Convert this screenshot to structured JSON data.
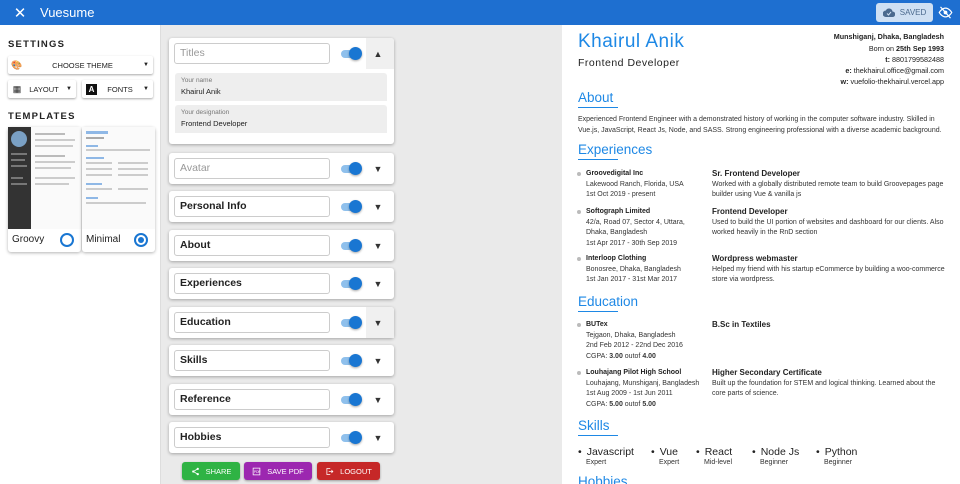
{
  "app": {
    "title": "Vuesume",
    "saved_label": "SAVED"
  },
  "settings": {
    "heading": "SETTINGS",
    "theme_label": "CHOOSE THEME",
    "layout_label": "LAYOUT",
    "fonts_label": "FONTS"
  },
  "templates": {
    "heading": "TEMPLATES",
    "items": [
      {
        "name": "Groovy",
        "selected": false
      },
      {
        "name": "Minimal",
        "selected": true
      }
    ]
  },
  "editor": {
    "titles": {
      "placeholder": "Titles",
      "name_label": "Your name",
      "name_value": "Khairul Anik",
      "designation_label": "Your designation",
      "designation_value": "Frontend Developer"
    },
    "avatar_placeholder": "Avatar",
    "sections": [
      "Personal Info",
      "About",
      "Experiences",
      "Education",
      "Skills",
      "Reference",
      "Hobbies"
    ],
    "actions": {
      "share": "SHARE",
      "save_pdf": "SAVE PDF",
      "logout": "LOGOUT"
    }
  },
  "colors": {
    "primary": "#1e6fd0",
    "accent": "#1e88e5",
    "share": "#2fb344",
    "pdf": "#9c27b0",
    "logout": "#c62828"
  },
  "resume": {
    "name": "Khairul Anik",
    "designation": "Frontend Developer",
    "address": "Munshiganj, Dhaka, Bangladesh",
    "born_prefix": "Born on ",
    "born": "25th Sep 1993",
    "phone_label": "t: ",
    "phone": "8801799582488",
    "email_label": "e: ",
    "email": "thekhairul.office@gmail.com",
    "web_label": "w: ",
    "web": "vuefolio-thekhairul.vercel.app",
    "about_title": "About",
    "about_text": "Experienced Frontend Engineer with a demonstrated history of working in the computer software industry. Skilled in Vue.js, JavaScript, React Js, Node, and SASS. Strong engineering professional with a diverse academic background.",
    "exp_title": "Experiences",
    "experiences": [
      {
        "company": "Groovedigital Inc",
        "location": "Lakewood Ranch, Florida, USA",
        "dates": "1st Oct 2019 - present",
        "role": "Sr. Frontend Developer",
        "desc": "Worked with a globally distributed remote team to build Groovepages page builder using Vue & vanilla js"
      },
      {
        "company": "Softograph Limited",
        "location": "42/a, Road 07, Sector 4, Uttara, Dhaka, Bangladesh",
        "dates": "1st Apr 2017 - 30th Sep 2019",
        "role": "Frontend Developer",
        "desc": "Used to build the UI portion of websites and dashboard for our clients. Also worked heavily in the RnD section"
      },
      {
        "company": "Interloop Clothing",
        "location": "Bonosree, Dhaka, Bangladesh",
        "dates": "1st Jan 2017 - 31st Mar 2017",
        "role": "Wordpress webmaster",
        "desc": "Helped my friend with his startup eCommerce by building a woo-commerce store via wordpress."
      }
    ],
    "edu_title": "Education",
    "education": [
      {
        "school": "BUTex",
        "location": "Tejgaon, Dhaka, Bangladesh",
        "dates": "2nd Feb 2012 - 22nd Dec 2016",
        "gpa_label": "CGPA: ",
        "gpa": "3.00",
        "gpa_sep": " outof ",
        "gpa_max": "4.00",
        "degree": "B.Sc in Textiles",
        "desc": ""
      },
      {
        "school": "Louhajang Pilot High School",
        "location": "Louhajang, Munshiganj, Bangladesh",
        "dates": "1st Aug 2009 - 1st Jun 2011",
        "gpa_label": "CGPA: ",
        "gpa": "5.00",
        "gpa_sep": " outof ",
        "gpa_max": "5.00",
        "degree": "Higher Secondary Certificate",
        "desc": "Built up the foundation for STEM and logical thinking. Learned about the core parts of science."
      }
    ],
    "skills_title": "Skills",
    "skills": [
      {
        "name": "Javascript",
        "level": "Expert"
      },
      {
        "name": "Vue",
        "level": "Expert"
      },
      {
        "name": "React",
        "level": "Mid-level"
      },
      {
        "name": "Node Js",
        "level": "Beginner"
      },
      {
        "name": "Python",
        "level": "Beginner"
      }
    ],
    "hobbies_title": "Hobbies"
  }
}
